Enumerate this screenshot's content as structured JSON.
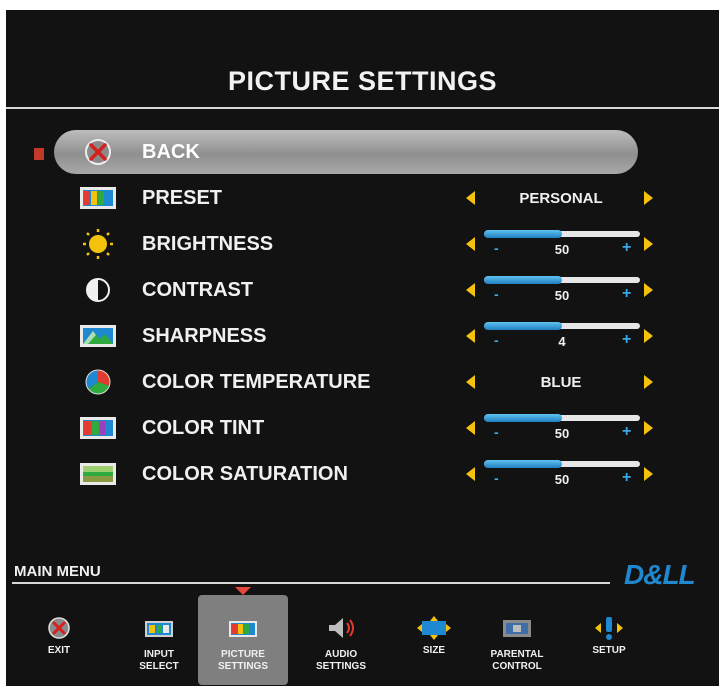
{
  "title": "PICTURE SETTINGS",
  "menu": [
    {
      "label": "BACK",
      "icon": "back-x-icon",
      "control": "none"
    },
    {
      "label": "PRESET",
      "icon": "preset-tv-icon",
      "control": "text",
      "value": "PERSONAL"
    },
    {
      "label": "BRIGHTNESS",
      "icon": "brightness-sun-icon",
      "control": "slider",
      "value": "50",
      "level": 0.5
    },
    {
      "label": "CONTRAST",
      "icon": "contrast-icon",
      "control": "slider",
      "value": "50",
      "level": 0.5
    },
    {
      "label": "SHARPNESS",
      "icon": "sharpness-icon",
      "control": "slider",
      "value": "4",
      "level": 0.5
    },
    {
      "label": "COLOR TEMPERATURE",
      "icon": "color-temperature-icon",
      "control": "text",
      "value": "BLUE"
    },
    {
      "label": "COLOR TINT",
      "icon": "color-tint-icon",
      "control": "slider",
      "value": "50",
      "level": 0.5
    },
    {
      "label": "COLOR SATURATION",
      "icon": "color-saturation-icon",
      "control": "slider",
      "value": "50",
      "level": 0.5
    }
  ],
  "slider_symbols": {
    "minus": "-",
    "plus": "+"
  },
  "main_menu_label": "MAIN MENU",
  "brand": "D&LL",
  "bottom_nav": [
    {
      "label": "EXIT",
      "icon": "exit-icon"
    },
    {
      "label": "INPUT\nSELECT",
      "icon": "input-select-icon"
    },
    {
      "label": "PICTURE\nSETTINGS",
      "icon": "picture-settings-icon",
      "active": true
    },
    {
      "label": "AUDIO\nSETTINGS",
      "icon": "audio-settings-icon"
    },
    {
      "label": "SIZE",
      "icon": "size-icon"
    },
    {
      "label": "PARENTAL\nCONTROL",
      "icon": "parental-control-icon"
    },
    {
      "label": "SETUP",
      "icon": "setup-icon"
    }
  ],
  "colors": {
    "accent_arrow": "#f4c20d",
    "slider_fill": "#1f7fc2",
    "brand": "#1e88d0",
    "selection_pointer": "#e5483b"
  }
}
